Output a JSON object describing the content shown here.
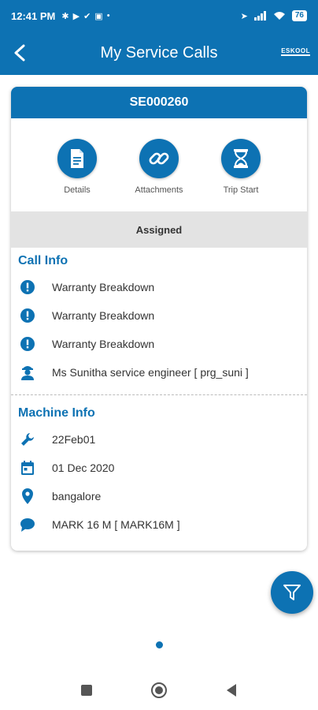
{
  "status_bar": {
    "time": "12:41 PM",
    "notification_icons": [
      "bluetooth-icon",
      "youtube-icon",
      "check-icon",
      "app-icon"
    ],
    "battery": "76"
  },
  "header": {
    "title": "My Service Calls",
    "logo_text": "ESKOOL"
  },
  "card": {
    "call_id": "SE000260",
    "actions": [
      {
        "label": "Details",
        "icon": "document-icon"
      },
      {
        "label": "Attachments",
        "icon": "link-icon"
      },
      {
        "label": "Trip Start",
        "icon": "hourglass-icon"
      }
    ],
    "status": "Assigned",
    "call_info": {
      "title": "Call Info",
      "items": [
        {
          "icon": "alert-icon",
          "text": "Warranty Breakdown"
        },
        {
          "icon": "alert-icon",
          "text": "Warranty Breakdown"
        },
        {
          "icon": "alert-icon",
          "text": "Warranty Breakdown"
        },
        {
          "icon": "engineer-icon",
          "text": "Ms Sunitha service engineer [ prg_suni ]"
        }
      ]
    },
    "machine_info": {
      "title": "Machine Info",
      "items": [
        {
          "icon": "wrench-icon",
          "text": "22Feb01"
        },
        {
          "icon": "calendar-icon",
          "text": "01 Dec 2020"
        },
        {
          "icon": "location-icon",
          "text": "bangalore"
        },
        {
          "icon": "comment-icon",
          "text": "MARK 16 M [ MARK16M ]"
        }
      ]
    }
  },
  "colors": {
    "primary": "#0d72b3",
    "status_background": "#e3e3e3"
  }
}
